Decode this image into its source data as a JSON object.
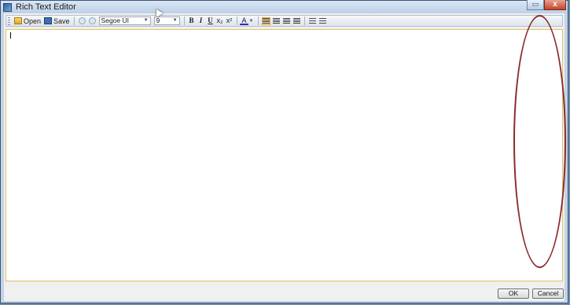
{
  "window": {
    "title": "Rich Text Editor",
    "minimize": "▭",
    "close": "x"
  },
  "toolbar": {
    "open_label": "Open",
    "save_label": "Save",
    "font_family": "Segoe UI",
    "font_size": "9",
    "bold": "B",
    "italic": "I",
    "underline": "U",
    "subscript": "x₂",
    "superscript": "x²",
    "font_color": "A"
  },
  "footer": {
    "ok_label": "OK",
    "cancel_label": "Cancel"
  }
}
